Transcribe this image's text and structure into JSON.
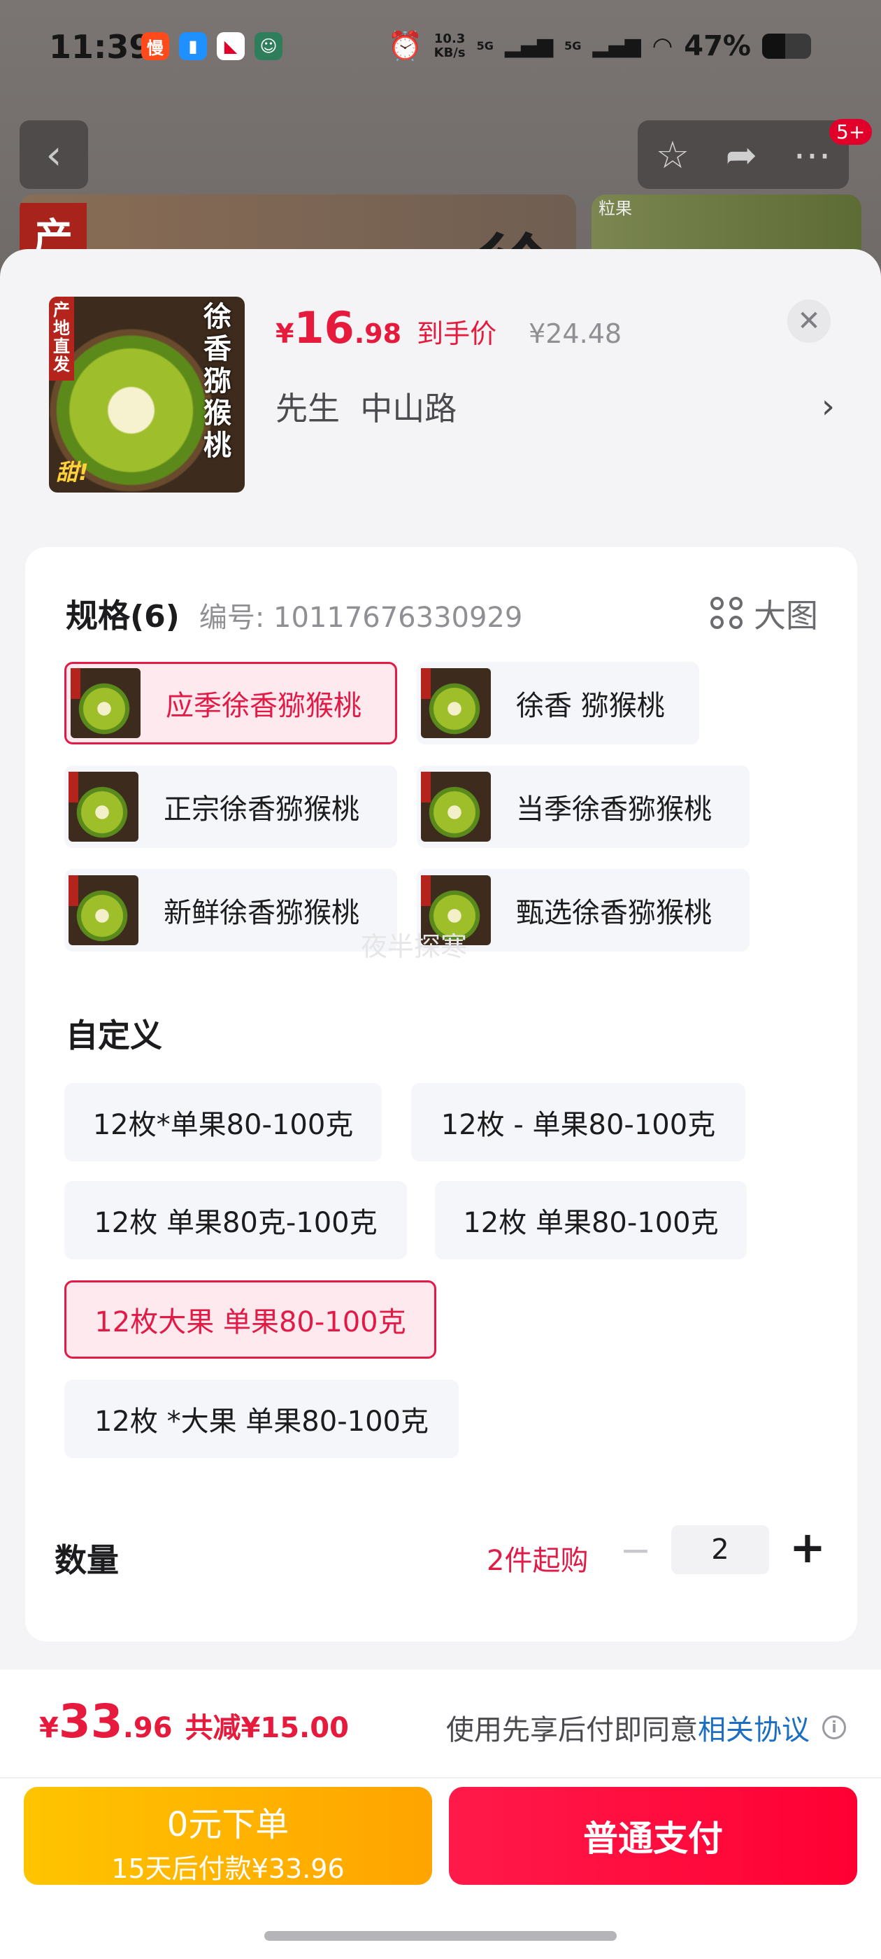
{
  "status": {
    "time": "11:39",
    "apps": [
      "慢",
      "",
      "",
      ""
    ],
    "speed_top": "10.3",
    "speed_bottom": "KB/s",
    "signal1": "5G",
    "signal2": "5G",
    "battery": "47%",
    "battery_level": 0.47
  },
  "nav": {
    "badge": "5+"
  },
  "background": {
    "banner_tag": "产",
    "banner_big": "徐",
    "right_label": "粒果"
  },
  "product": {
    "thumb_corner": "产地直发",
    "thumb_title": "徐香猕猴桃",
    "thumb_sweet": "甜!",
    "currency": "¥",
    "price_int": "16",
    "price_dec": ".98",
    "price_label": "到手价",
    "original_price": "¥24.48",
    "address": "先生  中山路"
  },
  "spec": {
    "title": "规格",
    "count": "(6)",
    "code": "编号: 10117676330929",
    "big_view": "大图",
    "options": [
      {
        "label": "应季徐香猕猴桃",
        "selected": true
      },
      {
        "label": "徐香 猕猴桃",
        "selected": false
      },
      {
        "label": "正宗徐香猕猴桃",
        "selected": false
      },
      {
        "label": "当季徐香猕猴桃",
        "selected": false
      },
      {
        "label": "新鲜徐香猕猴桃",
        "selected": false
      },
      {
        "label": "甄选徐香猕猴桃",
        "selected": false
      }
    ],
    "watermark": "夜半探寒"
  },
  "custom": {
    "title": "自定义",
    "options": [
      {
        "label": "12枚*单果80-100克",
        "selected": false
      },
      {
        "label": "12枚 - 单果80-100克",
        "selected": false
      },
      {
        "label": "12枚 单果80克-100克",
        "selected": false
      },
      {
        "label": "12枚 单果80-100克",
        "selected": false
      },
      {
        "label": "12枚大果 单果80-100克",
        "selected": true
      },
      {
        "label": "12枚 *大果 单果80-100克",
        "selected": false
      }
    ]
  },
  "quantity": {
    "label": "数量",
    "min_note": "2件起购",
    "minus": "−",
    "value": "2",
    "plus": "+"
  },
  "footer": {
    "currency": "¥",
    "total_int": "33",
    "total_dec": ".96",
    "saving": "共减¥15.00",
    "agree_text": "使用先享后付即同意",
    "agree_link": "相关协议",
    "info": "i",
    "later_line1": "0元下单",
    "later_line2": "15天后付款¥33.96",
    "pay_label": "普通支付"
  }
}
